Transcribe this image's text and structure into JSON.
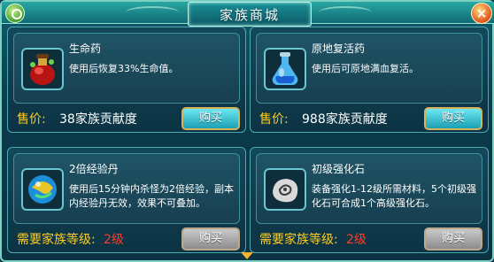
{
  "window": {
    "title": "家族商城"
  },
  "items": [
    {
      "name": "生命药",
      "desc": "使用后恢复33%生命值。",
      "price_label": "售价:",
      "price_value": "38家族贡献度",
      "buy_label": "购买",
      "icon": "red-potion-icon"
    },
    {
      "name": "原地复活药",
      "desc": "使用后可原地满血复活。",
      "price_label": "售价:",
      "price_value": "988家族贡献度",
      "buy_label": "购买",
      "icon": "blue-potion-icon"
    },
    {
      "name": "2倍经验丹",
      "desc": "使用后15分钟内杀怪为2倍经验，副本内经验丹无效，效果不可叠加。",
      "req_label": "需要家族等级:",
      "req_value": "2级",
      "buy_label": "购买",
      "icon": "exp-orb-icon"
    },
    {
      "name": "初级强化石",
      "desc": "装备强化1-12级所需材料，5个初级强化石可合成1个高级强化石。",
      "req_label": "需要家族等级:",
      "req_value": "2级",
      "buy_label": "购买",
      "icon": "stone-icon"
    }
  ],
  "colors": {
    "accent": "#ffcc22",
    "warning": "#ff3b2a"
  }
}
